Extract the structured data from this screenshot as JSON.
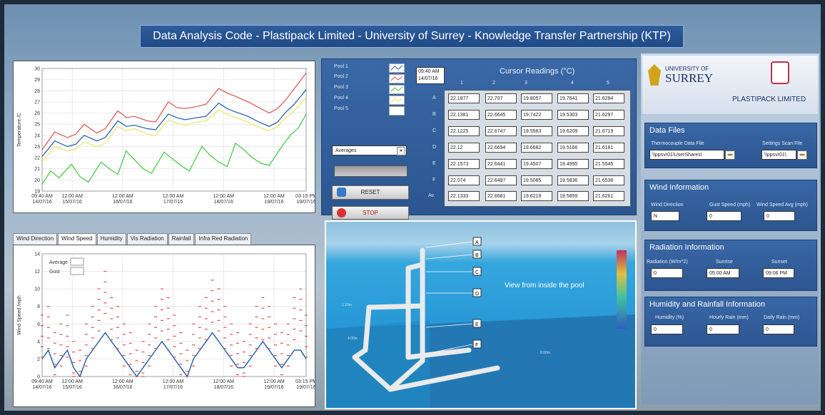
{
  "app": {
    "title": "Data Analysis Code - Plastipack Limited - University of Surrey - Knowledge Transfer Partnership (KTP)"
  },
  "colors": {
    "accent": "#2b5690",
    "pool1": "#1f5aa6",
    "pool2": "#e05050",
    "pool3": "#3cc83c",
    "pool4": "#e6e66a",
    "pool5": "#ffffff"
  },
  "temp_chart": {
    "chart_data": {
      "type": "line",
      "ylabel": "Temperature /C",
      "ylim": [
        19,
        30
      ],
      "yticks": [
        "19",
        "20",
        "21",
        "22",
        "23",
        "24",
        "25",
        "26",
        "27",
        "28",
        "29",
        "30"
      ],
      "xticks": [
        [
          "09:40 AM",
          "14/07/16"
        ],
        [
          "12:00 AM",
          "15/07/16"
        ],
        [
          "12:00 AM",
          "16/07/16"
        ],
        [
          "12:00 AM",
          "17/07/16"
        ],
        [
          "12:00 AM",
          "18/07/16"
        ],
        [
          "12:00 AM",
          "19/07/16"
        ],
        [
          "03:15 PM",
          "19/07/16"
        ]
      ],
      "x_hours": [
        0,
        14.3,
        38.3,
        62.3,
        86.3,
        110.3,
        125.6
      ],
      "series": [
        {
          "name": "Pool 2",
          "color": "#e05050",
          "x": [
            0,
            6,
            12,
            16,
            20,
            26,
            30,
            36,
            40,
            44,
            50,
            54,
            60,
            64,
            68,
            74,
            78,
            84,
            88,
            92,
            98,
            102,
            108,
            112,
            116,
            120,
            125.6
          ],
          "values": [
            22.7,
            24.3,
            23.8,
            24.1,
            25.0,
            24.2,
            24.6,
            26.2,
            25.6,
            25.7,
            25.3,
            25.2,
            27.0,
            26.5,
            26.4,
            26.6,
            26.8,
            28.2,
            27.8,
            27.5,
            27.0,
            26.6,
            26.0,
            26.4,
            27.2,
            28.2,
            29.6
          ]
        },
        {
          "name": "Pool 1",
          "color": "#1f5aa6",
          "x": [
            0,
            6,
            12,
            16,
            20,
            26,
            30,
            36,
            40,
            44,
            50,
            54,
            60,
            64,
            68,
            74,
            78,
            84,
            88,
            92,
            98,
            102,
            108,
            112,
            116,
            120,
            125.6
          ],
          "values": [
            22.1,
            23.5,
            23.0,
            23.2,
            24.0,
            23.5,
            23.8,
            25.3,
            24.8,
            24.9,
            24.6,
            24.5,
            25.9,
            25.6,
            25.4,
            25.6,
            25.7,
            26.9,
            26.4,
            26.1,
            25.7,
            25.3,
            24.8,
            25.2,
            26.1,
            26.8,
            28.1
          ]
        },
        {
          "name": "Pool 4",
          "color": "#e6e66a",
          "x": [
            0,
            6,
            12,
            16,
            20,
            26,
            30,
            36,
            40,
            44,
            50,
            54,
            60,
            64,
            68,
            74,
            78,
            84,
            88,
            92,
            98,
            102,
            108,
            112,
            116,
            120,
            125.6
          ],
          "values": [
            21.6,
            23.0,
            22.6,
            22.8,
            23.4,
            23.0,
            23.3,
            24.8,
            24.4,
            24.6,
            24.1,
            24.0,
            25.4,
            25.1,
            24.9,
            25.2,
            25.3,
            26.3,
            25.9,
            25.6,
            25.2,
            24.8,
            24.4,
            24.8,
            25.6,
            26.2,
            27.4
          ]
        },
        {
          "name": "Pool 3",
          "color": "#3cc83c",
          "x": [
            0,
            4,
            8,
            14,
            18,
            22,
            28,
            32,
            36,
            40,
            44,
            48,
            52,
            58,
            62,
            66,
            70,
            76,
            80,
            84,
            88,
            92,
            96,
            100,
            104,
            108,
            114,
            118,
            122,
            125.6
          ],
          "values": [
            19.6,
            20.8,
            20.2,
            21.4,
            20.3,
            19.8,
            21.6,
            21.0,
            20.5,
            22.6,
            21.8,
            21.0,
            20.6,
            22.5,
            21.9,
            21.3,
            20.8,
            23.0,
            22.2,
            21.6,
            21.2,
            23.3,
            22.7,
            22.0,
            21.5,
            21.3,
            23.0,
            24.0,
            24.7,
            25.9
          ]
        }
      ]
    }
  },
  "wind_chart": {
    "tabs": [
      "Wind Direction",
      "Wind Speed",
      "Humidity",
      "Vis Radiation",
      "Rainfall",
      "Infra Red Radiation"
    ],
    "active_tab": "Wind Speed",
    "chart_data": {
      "type": "line",
      "ylabel": "Wind Speed /mph",
      "ylim": [
        0,
        14
      ],
      "yticks": [
        "0",
        "2",
        "4",
        "6",
        "8",
        "10",
        "12",
        "14"
      ],
      "legend": [
        {
          "name": "Average"
        },
        {
          "name": "Gust"
        }
      ],
      "xticks": [
        [
          "09:40 AM",
          "14/07/16"
        ],
        [
          "12:00 AM",
          "15/07/16"
        ],
        [
          "12:00 AM",
          "16/07/16"
        ],
        [
          "12:00 AM",
          "17/07/16"
        ],
        [
          "12:00 AM",
          "18/07/16"
        ],
        [
          "12:00 AM",
          "19/07/16"
        ],
        [
          "03:15 PM",
          "19/07/16"
        ]
      ],
      "x_hours": [
        0,
        14.3,
        38.3,
        62.3,
        86.3,
        110.3,
        125.6
      ],
      "series": [
        {
          "name": "Average",
          "color": "#1f5aa6",
          "x": [
            0,
            3,
            6,
            9,
            12,
            15,
            18,
            21,
            24,
            27,
            30,
            33,
            36,
            39,
            42,
            45,
            48,
            51,
            54,
            57,
            60,
            63,
            66,
            69,
            72,
            75,
            78,
            81,
            84,
            87,
            90,
            93,
            96,
            99,
            102,
            105,
            108,
            111,
            114,
            117,
            120,
            123,
            125.6
          ],
          "values": [
            2,
            3,
            1,
            2,
            3,
            1,
            0,
            2,
            3,
            4,
            5,
            4,
            3,
            2,
            1,
            0,
            1,
            2,
            3,
            4,
            3,
            2,
            1,
            0,
            2,
            3,
            4,
            5,
            4,
            3,
            2,
            1,
            1,
            2,
            3,
            4,
            3,
            2,
            1,
            2,
            3,
            3,
            2
          ]
        },
        {
          "name": "Gust",
          "color": "#e05050",
          "x": [
            0,
            3,
            6,
            9,
            12,
            15,
            18,
            21,
            24,
            27,
            30,
            33,
            36,
            39,
            42,
            45,
            48,
            51,
            54,
            57,
            60,
            63,
            66,
            69,
            72,
            75,
            78,
            81,
            84,
            87,
            90,
            93,
            96,
            99,
            102,
            105,
            108,
            111,
            114,
            117,
            120,
            123,
            125.6
          ],
          "values": [
            7,
            8,
            5,
            6,
            7,
            4,
            3,
            6,
            8,
            10,
            12,
            9,
            8,
            6,
            5,
            3,
            4,
            6,
            8,
            10,
            9,
            7,
            5,
            3,
            6,
            8,
            9,
            11,
            10,
            8,
            6,
            5,
            4,
            6,
            8,
            9,
            8,
            6,
            5,
            6,
            9,
            10,
            7
          ]
        }
      ]
    }
  },
  "pools": [
    {
      "label": "Pool 1"
    },
    {
      "label": "Pool 2"
    },
    {
      "label": "Pool 3"
    },
    {
      "label": "Pool 4"
    },
    {
      "label": "Pool 5"
    }
  ],
  "cursor": {
    "time": "09:40 AM",
    "date": "14/07/16",
    "title": "Cursor Readings (°C)",
    "columns": [
      "1",
      "2",
      "3",
      "4",
      "5"
    ],
    "rows": [
      {
        "label": "A",
        "values": [
          "22.1877",
          "22.707",
          "19.8057",
          "19.7641",
          "21.6284"
        ]
      },
      {
        "label": "B",
        "values": [
          "22.1381",
          "22.6645",
          "19.7422",
          "19.5303",
          "21.6297"
        ]
      },
      {
        "label": "C",
        "values": [
          "22.1225",
          "22.6747",
          "19.5563",
          "19.6209",
          "21.6719"
        ]
      },
      {
        "label": "D",
        "values": [
          "22.12",
          "22.6694",
          "19.6682",
          "19.5166",
          "21.6181"
        ]
      },
      {
        "label": "E",
        "values": [
          "22.1573",
          "22.6441",
          "19.4507",
          "19.4995",
          "21.5545"
        ]
      },
      {
        "label": "F",
        "values": [
          "22.074",
          "22.6487",
          "19.5085",
          "19.5836",
          "21.6538"
        ]
      },
      {
        "label": "Av.",
        "values": [
          "22.1333",
          "22.6681",
          "19.6219",
          "19.5859",
          "21.6261"
        ]
      }
    ]
  },
  "controls": {
    "mode": "Averages",
    "reset": "RESET",
    "stop": "STOP"
  },
  "scene": {
    "caption": "View from inside the pool",
    "markers": [
      "A",
      "B",
      "C",
      "D",
      "E",
      "F"
    ],
    "dims": [
      "1.10m",
      "4.00m",
      "8.00m"
    ]
  },
  "logos": {
    "surrey": "UNIVERSITY OF",
    "surrey2": "SURREY",
    "plastipack": "PLASTIPACK LIMITED"
  },
  "data_files": {
    "title": "Data Files",
    "thermo_label": "Thermocouple Data File",
    "thermo_value": "\\\\ppsvr01\\UserShares\\",
    "settings_label": "Settings Scan File",
    "settings_value": "\\\\ppsvr01\\"
  },
  "wind_info": {
    "title": "Wind Information",
    "dir_label": "Wind Direction",
    "dir_value": "N",
    "gust_label": "Gust Speed (mph)",
    "gust_value": "0",
    "avg_label": "Wind Speed Avg (mph)",
    "avg_value": "0"
  },
  "radiation_info": {
    "title": "Radiation Information",
    "rad_label": "Radiation (W/m^2)",
    "rad_value": "0",
    "sunrise_label": "Sunrise",
    "sunrise_value": "05:00 AM",
    "sunset_label": "Sunset",
    "sunset_value": "09:06 PM"
  },
  "humidity_info": {
    "title": "Humidity and Rainfall Information",
    "hum_label": "Humidity (%)",
    "hum_value": "0",
    "hourly_label": "Hourly Rain (mm)",
    "hourly_value": "0",
    "daily_label": "Daily Rain (mm)",
    "daily_value": "0"
  }
}
